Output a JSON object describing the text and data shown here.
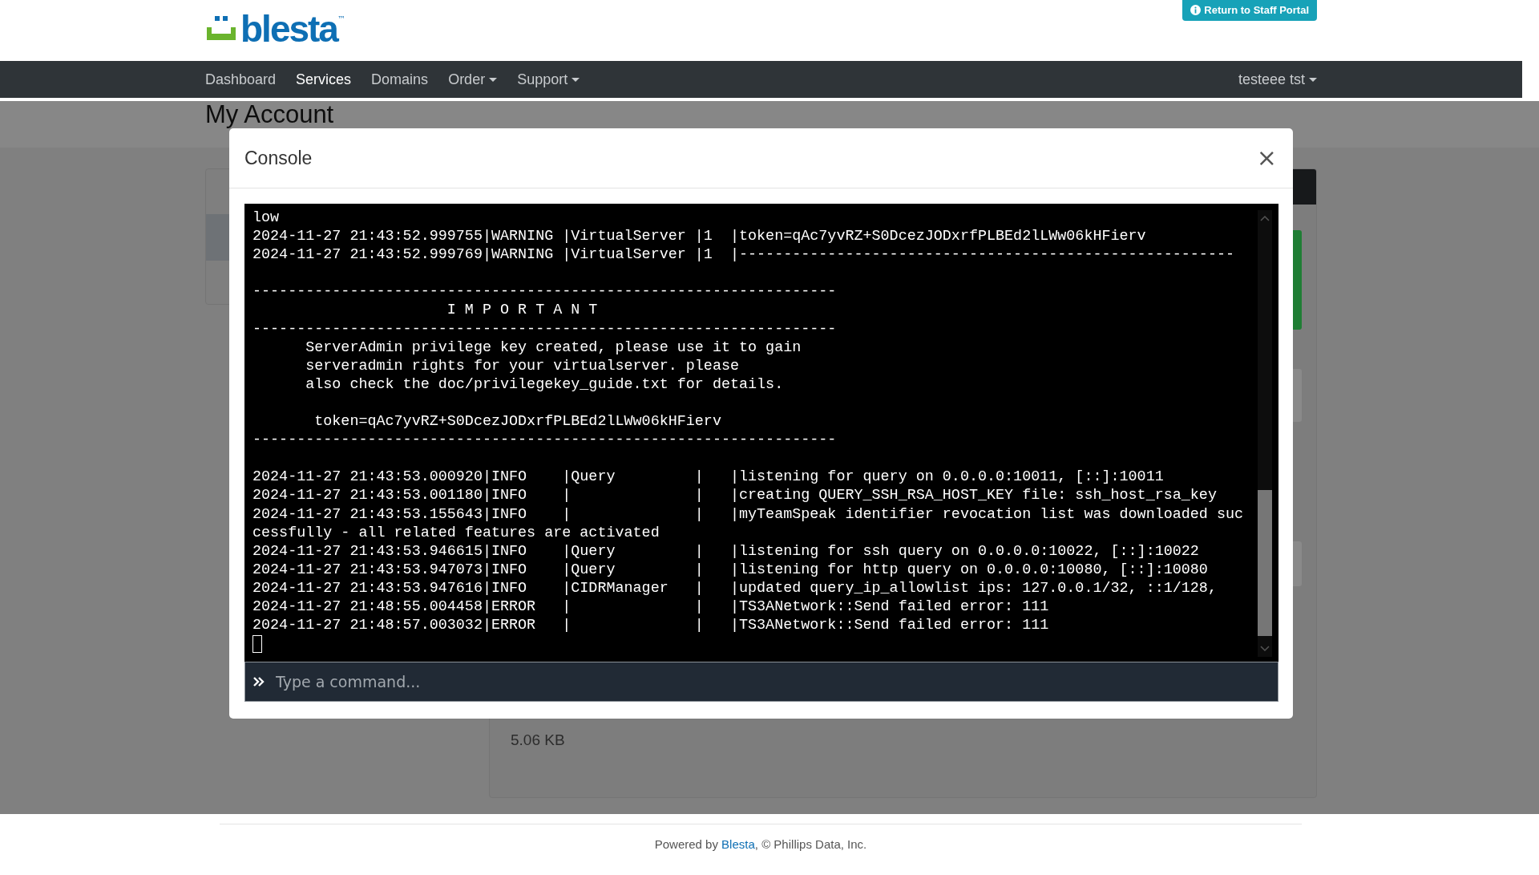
{
  "header": {
    "logo": {
      "text": "blesta",
      "mark": "™"
    },
    "staff_button": {
      "label": "Return to Staff Portal"
    }
  },
  "nav": {
    "items": [
      {
        "label": "Dashboard",
        "selected": false,
        "dropdown": false
      },
      {
        "label": "Services",
        "selected": true,
        "dropdown": false
      },
      {
        "label": "Domains",
        "selected": false,
        "dropdown": false
      },
      {
        "label": "Order",
        "selected": false,
        "dropdown": true
      },
      {
        "label": "Support",
        "selected": false,
        "dropdown": true
      }
    ],
    "user": {
      "label": "testeee tst",
      "dropdown": true
    }
  },
  "page": {
    "title": "My Account",
    "file_size": "5.06 KB"
  },
  "modal": {
    "title": "Console",
    "close": "×",
    "console": {
      "log": "low\n2024-11-27 21:43:52.999755|WARNING |VirtualServer |1  |token=qAc7yvRZ+S0DcezJODxrfPLBEd2lLWw06kHFierv\n2024-11-27 21:43:52.999769|WARNING |VirtualServer |1  |--------------------------------------------------------\n\n------------------------------------------------------------------\n                      I M P O R T A N T\n------------------------------------------------------------------\n      ServerAdmin privilege key created, please use it to gain\n      serveradmin rights for your virtualserver. please\n      also check the doc/privilegekey_guide.txt for details.\n\n       token=qAc7yvRZ+S0DcezJODxrfPLBEd2lLWw06kHFierv\n------------------------------------------------------------------\n\n2024-11-27 21:43:53.000920|INFO    |Query         |   |listening for query on 0.0.0.0:10011, [::]:10011\n2024-11-27 21:43:53.001180|INFO    |              |   |creating QUERY_SSH_RSA_HOST_KEY file: ssh_host_rsa_key\n2024-11-27 21:43:53.155643|INFO    |              |   |myTeamSpeak identifier revocation list was downloaded suc\ncessfully - all related features are activated\n2024-11-27 21:43:53.946615|INFO    |Query         |   |listening for ssh query on 0.0.0.0:10022, [::]:10022\n2024-11-27 21:43:53.947073|INFO    |Query         |   |listening for http query on 0.0.0.0:10080, [::]:10080\n2024-11-27 21:43:53.947616|INFO    |CIDRManager   |   |updated query_ip_allowlist ips: 127.0.0.1/32, ::1/128,\n2024-11-27 21:48:55.004458|ERROR   |              |   |TS3ANetwork::Send failed error: 111\n2024-11-27 21:48:57.003032|ERROR   |              |   |TS3ANetwork::Send failed error: 111"
    },
    "command": {
      "placeholder": "Type a command..."
    }
  },
  "footer": {
    "prefix": "Powered by ",
    "link": "Blesta",
    "suffix": ", © Phillips Data, Inc."
  }
}
